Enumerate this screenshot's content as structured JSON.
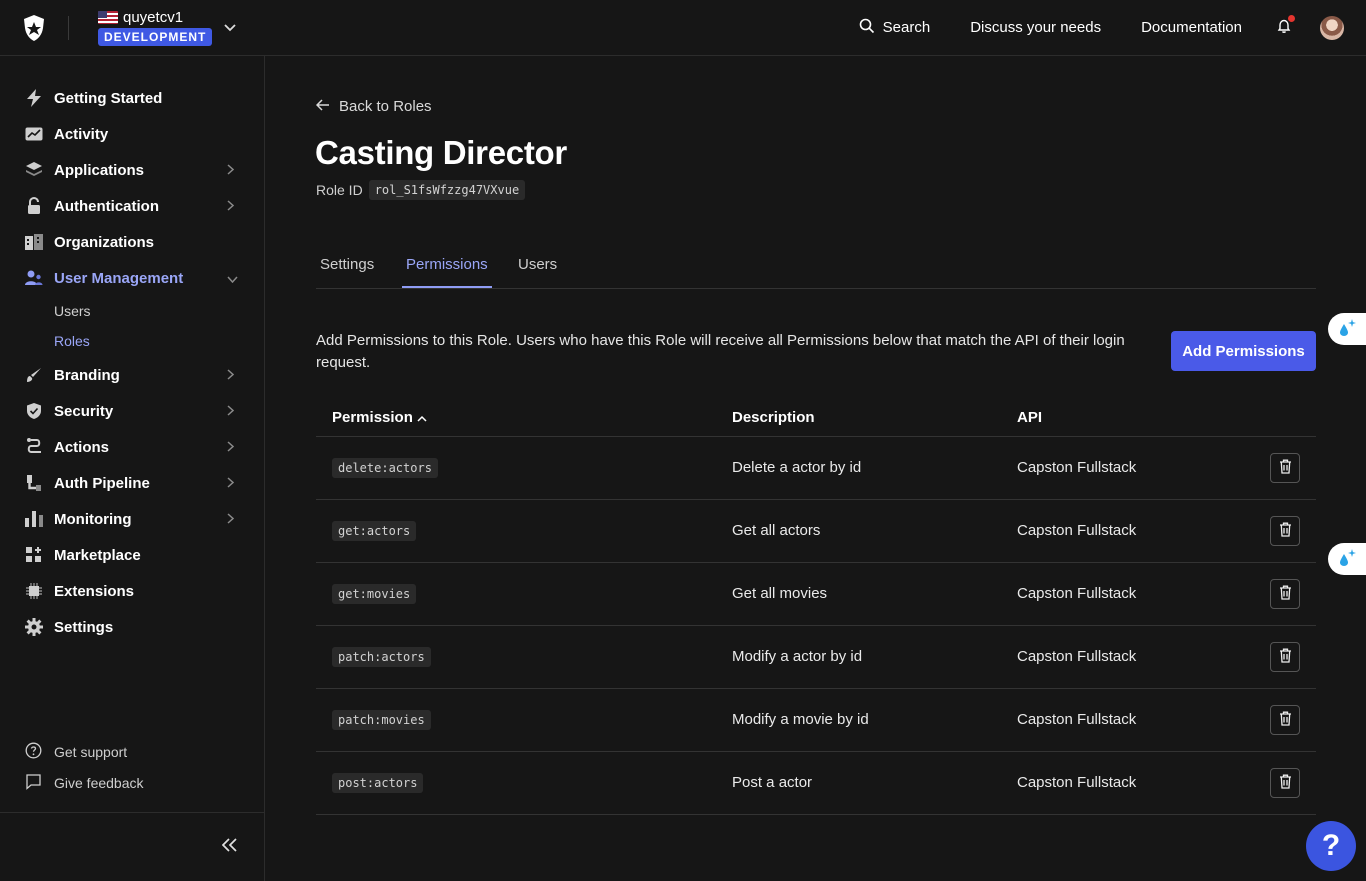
{
  "header": {
    "tenant_name": "quyetcv1",
    "environment_badge": "DEVELOPMENT",
    "search_label": "Search",
    "discuss_label": "Discuss your needs",
    "docs_label": "Documentation"
  },
  "sidebar": {
    "items": [
      {
        "label": "Getting Started",
        "icon": "lightning-icon",
        "chevron": false
      },
      {
        "label": "Activity",
        "icon": "activity-chart-icon",
        "chevron": false
      },
      {
        "label": "Applications",
        "icon": "layers-icon",
        "chevron": true
      },
      {
        "label": "Authentication",
        "icon": "lock-icon",
        "chevron": true
      },
      {
        "label": "Organizations",
        "icon": "building-icon",
        "chevron": false
      },
      {
        "label": "User Management",
        "icon": "users-icon",
        "chevron": true,
        "expanded": true
      },
      {
        "label": "Branding",
        "icon": "brush-icon",
        "chevron": true
      },
      {
        "label": "Security",
        "icon": "shield-icon",
        "chevron": true
      },
      {
        "label": "Actions",
        "icon": "flow-icon",
        "chevron": true
      },
      {
        "label": "Auth Pipeline",
        "icon": "pipeline-icon",
        "chevron": true
      },
      {
        "label": "Monitoring",
        "icon": "bar-chart-icon",
        "chevron": true
      },
      {
        "label": "Marketplace",
        "icon": "grid-plus-icon",
        "chevron": false
      },
      {
        "label": "Extensions",
        "icon": "chip-icon",
        "chevron": false
      },
      {
        "label": "Settings",
        "icon": "gear-icon",
        "chevron": false
      }
    ],
    "sub_items": [
      {
        "label": "Users"
      },
      {
        "label": "Roles"
      }
    ],
    "footer": {
      "support_label": "Get support",
      "feedback_label": "Give feedback"
    }
  },
  "page": {
    "back_label": "Back to Roles",
    "title": "Casting Director",
    "role_id_label": "Role ID",
    "role_id_value": "rol_S1fsWfzzg47VXvue",
    "tabs": [
      {
        "label": "Settings"
      },
      {
        "label": "Permissions",
        "active": true
      },
      {
        "label": "Users"
      }
    ],
    "description": "Add Permissions to this Role. Users who have this Role will receive all Permissions below that match the API of their login request.",
    "add_button_label": "Add Permissions"
  },
  "table": {
    "columns": [
      "Permission",
      "Description",
      "API"
    ],
    "rows": [
      {
        "permission": "delete:actors",
        "description": "Delete a actor by id",
        "api": "Capston Fullstack"
      },
      {
        "permission": "get:actors",
        "description": "Get all actors",
        "api": "Capston Fullstack"
      },
      {
        "permission": "get:movies",
        "description": "Get all movies",
        "api": "Capston Fullstack"
      },
      {
        "permission": "patch:actors",
        "description": "Modify a actor by id",
        "api": "Capston Fullstack"
      },
      {
        "permission": "patch:movies",
        "description": "Modify a movie by id",
        "api": "Capston Fullstack"
      },
      {
        "permission": "post:actors",
        "description": "Post a actor",
        "api": "Capston Fullstack"
      }
    ]
  },
  "help_label": "?",
  "colors": {
    "accent": "#4a5ae8",
    "active_text": "#9aa6f7",
    "background": "#161616",
    "notification_dot": "#e4352f"
  }
}
